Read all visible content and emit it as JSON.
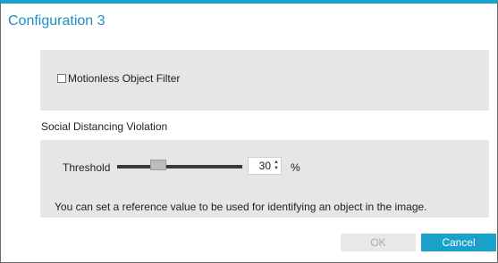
{
  "dialog": {
    "title": "Configuration 3"
  },
  "filter": {
    "checkbox_label": "Motionless Object Filter",
    "checked": false
  },
  "social_distancing": {
    "section_label": "Social Distancing Violation",
    "threshold_label": "Threshold",
    "threshold_value": "30",
    "unit": "%",
    "slider_value_percent": 30,
    "info_text": "You can set a reference value to be used for identifying an object in the image."
  },
  "buttons": {
    "ok_label": "OK",
    "cancel_label": "Cancel"
  },
  "colors": {
    "accent": "#1aa1c9",
    "panel_bg": "#e6e6e6",
    "title_text": "#1d8fc0"
  }
}
